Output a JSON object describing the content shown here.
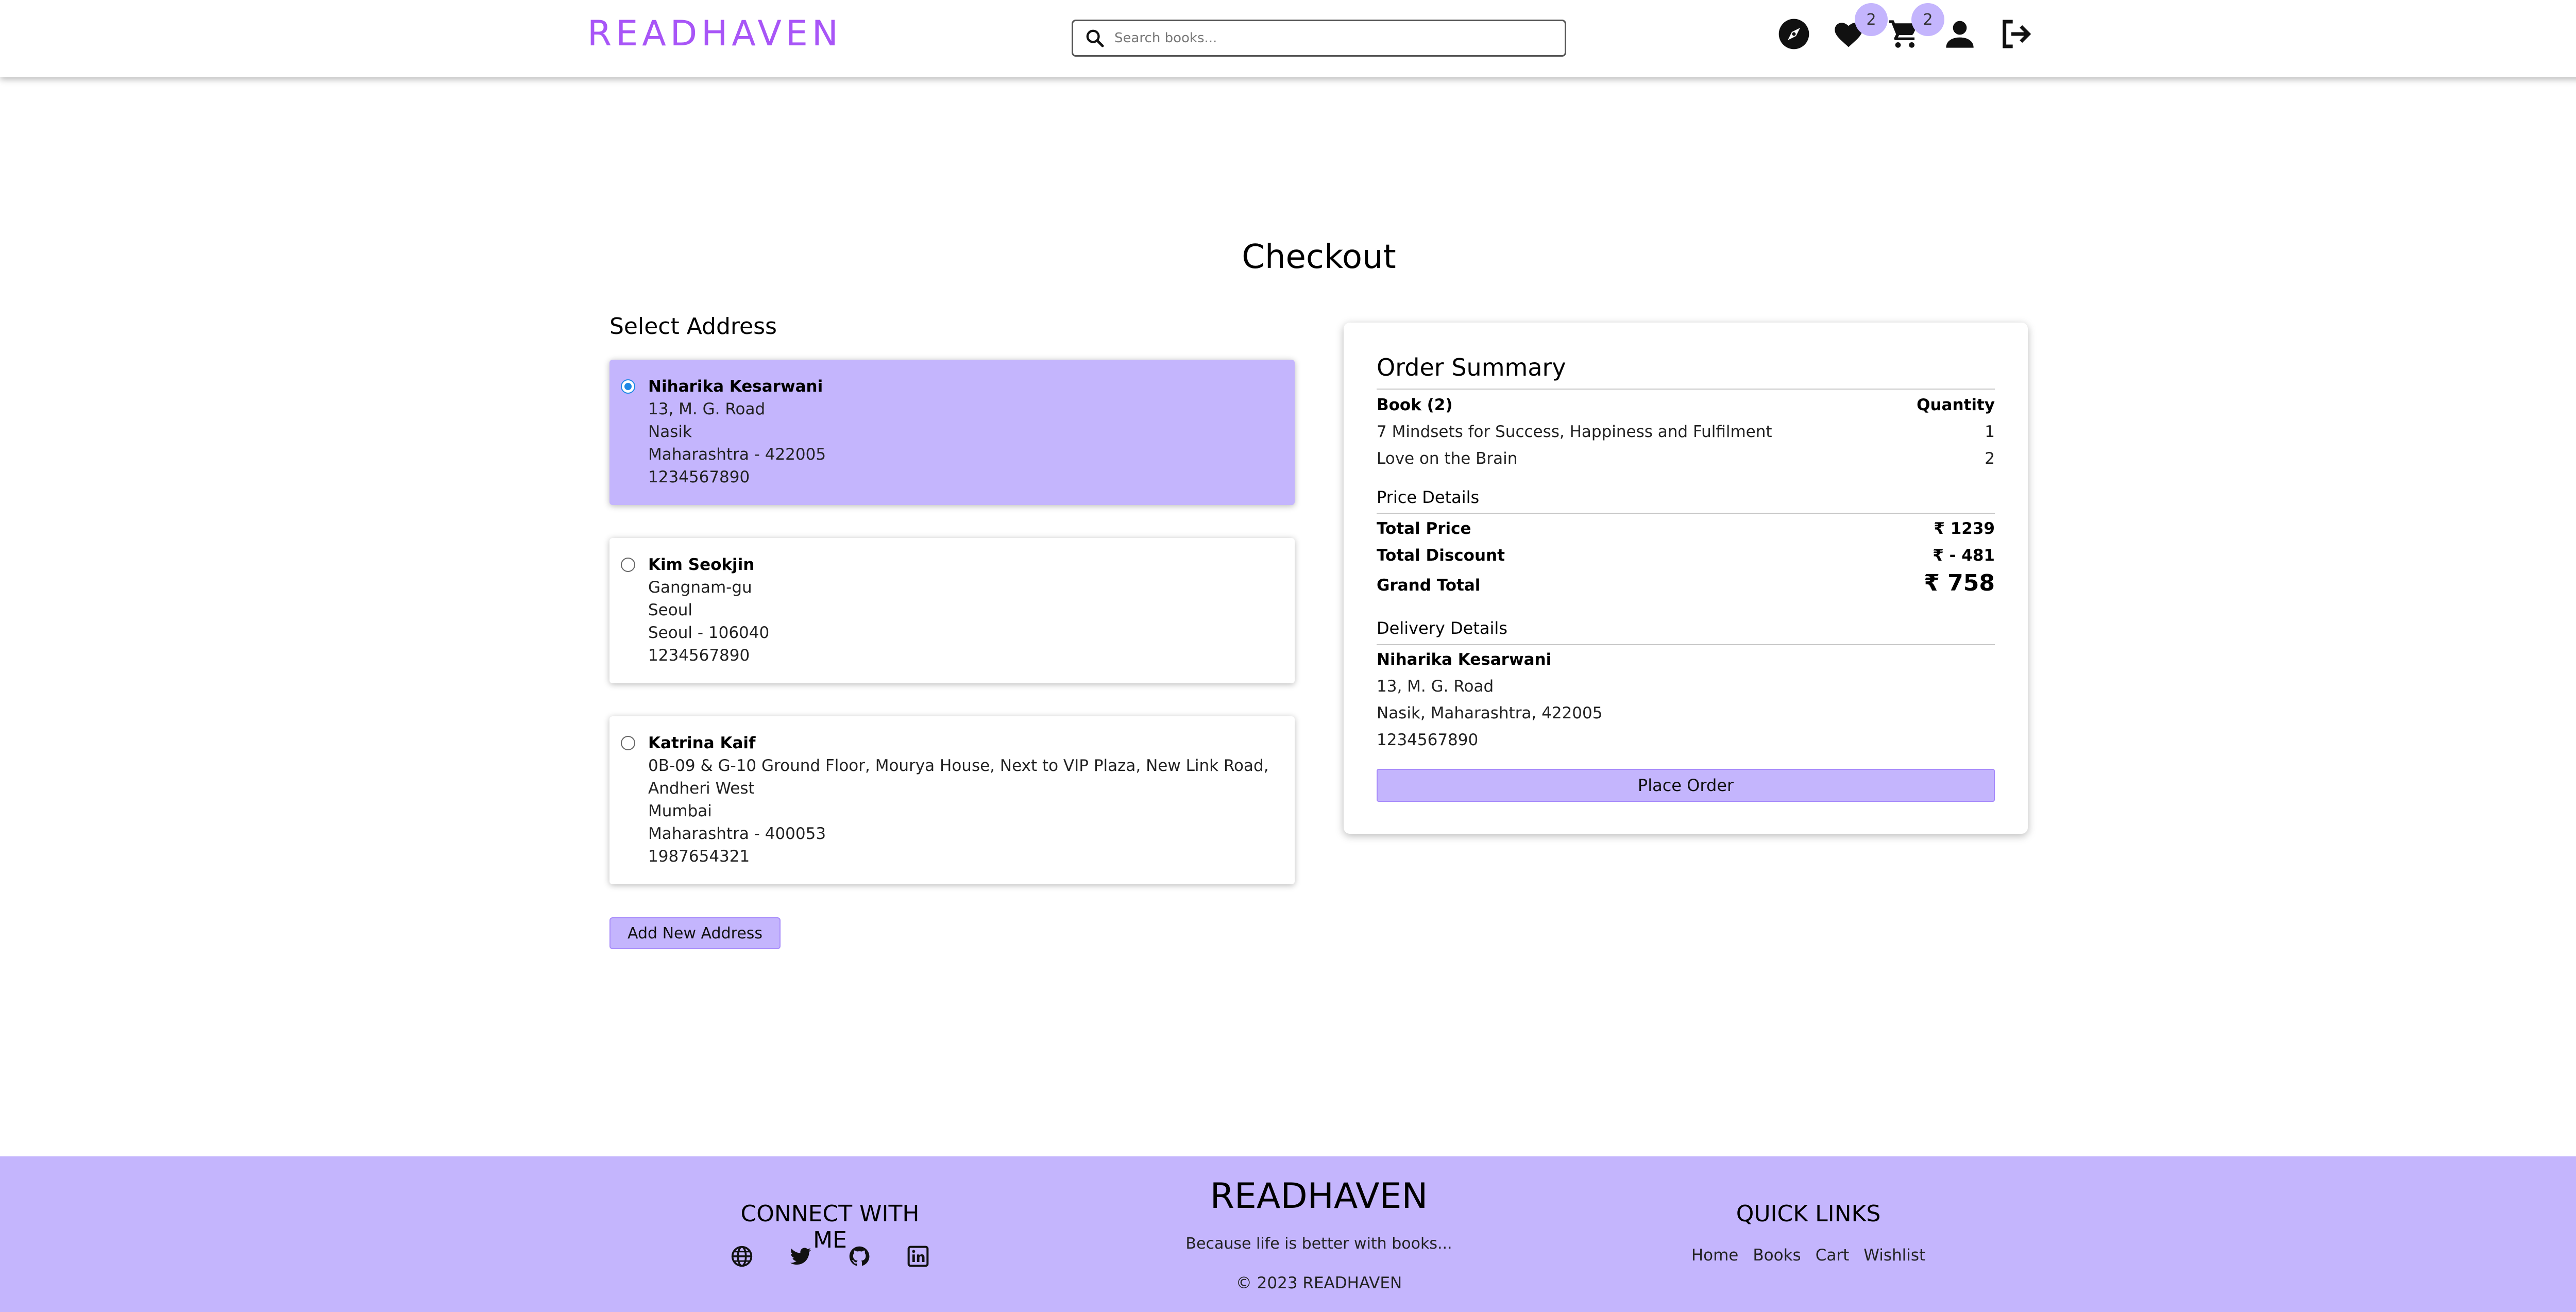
{
  "header": {
    "brand": "READHAVEN",
    "search_placeholder": "Search books...",
    "wishlist_count": "2",
    "cart_count": "2"
  },
  "page_title": "Checkout",
  "addresses": {
    "title": "Select Address",
    "items": [
      {
        "selected": true,
        "name": "Niharika Kesarwani",
        "line1": "13, M. G. Road",
        "city": "Nasik",
        "state_zip": "Maharashtra - 422005",
        "phone": "1234567890"
      },
      {
        "selected": false,
        "name": "Kim Seokjin",
        "line1": "Gangnam-gu",
        "city": "Seoul",
        "state_zip": "Seoul - 106040",
        "phone": "1234567890"
      },
      {
        "selected": false,
        "name": "Katrina Kaif",
        "line1": "0B-09 & G-10 Ground Floor, Mourya House, Next to VIP Plaza, New Link Road,",
        "line2": "Andheri West",
        "city": "Mumbai",
        "state_zip": "Maharashtra - 400053",
        "phone": "1987654321"
      }
    ],
    "add_label": "Add New Address"
  },
  "summary": {
    "title": "Order Summary",
    "book_header": "Book (2)",
    "qty_header": "Quantity",
    "books": [
      {
        "title": "7 Mindsets for Success, Happiness and Fulfilment",
        "qty": "1"
      },
      {
        "title": "Love on the Brain",
        "qty": "2"
      }
    ],
    "price_title": "Price Details",
    "total_price_label": "Total Price",
    "total_price_value": "₹ 1239",
    "total_discount_label": "Total Discount",
    "total_discount_value": "₹ - 481",
    "grand_total_label": "Grand Total",
    "grand_total_value": "₹ 758",
    "delivery_title": "Delivery Details",
    "delivery_name": "Niharika Kesarwani",
    "delivery_line1": "13, M. G. Road",
    "delivery_line2": "Nasik, Maharashtra, 422005",
    "delivery_phone": "1234567890",
    "place_order": "Place Order"
  },
  "footer": {
    "connect_title": "CONNECT WITH ME",
    "social_icons": [
      "globe-icon",
      "twitter-icon",
      "github-icon",
      "linkedin-icon"
    ],
    "brand": "READHAVEN",
    "tagline": "Because life is better with books...",
    "copyright": "© 2023 READHAVEN",
    "quick_links_title": "QUICK LINKS",
    "links": [
      "Home",
      "Books",
      "Cart",
      "Wishlist"
    ]
  },
  "colors": {
    "brand": "#a855f7",
    "accent": "#c4b5fd",
    "radio": "#1e88e5"
  }
}
